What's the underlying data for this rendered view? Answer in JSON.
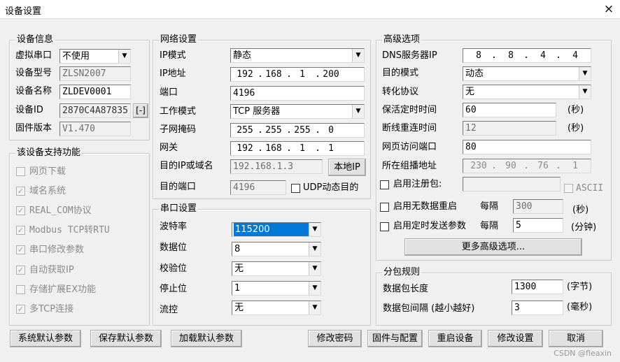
{
  "window": {
    "title": "设备设置",
    "close": "×"
  },
  "info": {
    "title": "设备信息",
    "virt_port_label": "虚拟串口",
    "virt_port": "不使用",
    "model_label": "设备型号",
    "model": "ZLSN2007",
    "name_label": "设备名称",
    "name": "ZLDEV0001",
    "id_label": "设备ID",
    "id": "2870C4A87835",
    "id_btn": "[-]",
    "fw_label": "固件版本",
    "fw": "V1.470"
  },
  "features": {
    "title": "该设备支持功能",
    "items": [
      "网页下载",
      "域名系统",
      "REAL_COM协议",
      "Modbus TCP转RTU",
      "串口修改参数",
      "自动获取IP",
      "存储扩展EX功能",
      "多TCP连接"
    ],
    "checked": [
      "",
      "✓",
      "✓",
      "✓",
      "✓",
      "✓",
      "",
      "✓"
    ]
  },
  "network": {
    "title": "网络设置",
    "ip_mode_label": "IP模式",
    "ip_mode": "静态",
    "ip_label": "IP地址",
    "ip": [
      "192",
      "168",
      "1",
      "200"
    ],
    "port_label": "端口",
    "port": "4196",
    "work_mode_label": "工作模式",
    "work_mode": "TCP 服务器",
    "mask_label": "子网掩码",
    "mask": [
      "255",
      "255",
      "255",
      "0"
    ],
    "gw_label": "网关",
    "gw": [
      "192",
      "168",
      "1",
      "1"
    ],
    "dest_label": "目的IP或域名",
    "dest": "192.168.1.3",
    "local_ip_btn": "本地IP",
    "dest_port_label": "目的端口",
    "dest_port": "4196",
    "udp_label": "UDP动态目的"
  },
  "serial": {
    "title": "串口设置",
    "baud_label": "波特率",
    "baud": "115200",
    "data_label": "数据位",
    "data": "8",
    "parity_label": "校验位",
    "parity": "无",
    "stop_label": "停止位",
    "stop": "1",
    "flow_label": "流控",
    "flow": "无"
  },
  "advanced": {
    "title": "高级选项",
    "dns_label": "DNS服务器IP",
    "dns": [
      "8",
      "8",
      "4",
      "4"
    ],
    "dest_mode_label": "目的模式",
    "dest_mode": "动态",
    "proto_label": "转化协议",
    "proto": "无",
    "keepalive_label": "保活定时时间",
    "keepalive": "60",
    "sec": "(秒)",
    "reconnect_label": "断线重连时间",
    "reconnect": "12",
    "web_port_label": "网页访问端口",
    "web_port": "80",
    "group_label": "所在组播地址",
    "group": [
      "230",
      "90",
      "76",
      "1"
    ],
    "reg_label": "启用注册包:",
    "ascii_label": "ASCII",
    "nodata_label": "启用无数据重启",
    "every": "每隔",
    "nodata_val": "300",
    "sec2": "(秒)",
    "timed_label": "启用定时发送参数",
    "every2": "每隔",
    "timed_val": "5",
    "minute": "(分钟)",
    "more_btn": "更多高级选项..."
  },
  "packet": {
    "title": "分包规则",
    "len_label": "数据包长度",
    "len": "1300",
    "byte_unit": "(字节)",
    "gap_label": "数据包间隔 (越小越好)",
    "gap": "3",
    "ms_unit": "(毫秒)"
  },
  "buttons": {
    "sys_default": "系统默认参数",
    "save_default": "保存默认参数",
    "load_default": "加载默认参数",
    "change_pwd": "修改密码",
    "fw_config": "固件与配置",
    "restart": "重启设备",
    "modify": "修改设置",
    "cancel": "取消"
  },
  "watermark": "CSDN @fleaxin"
}
